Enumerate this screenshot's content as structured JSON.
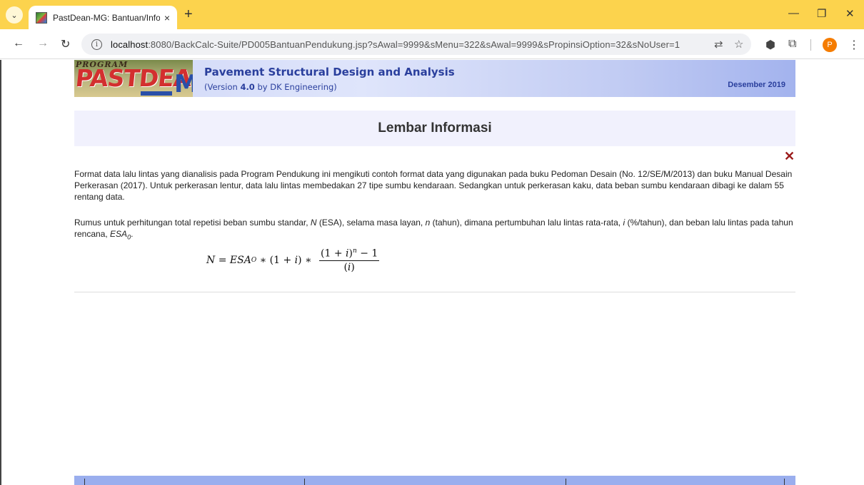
{
  "browser": {
    "tab_title": "PastDean-MG: Bantuan/Informa",
    "tab_close": "×",
    "new_tab": "+",
    "url_host": "localhost",
    "url_rest": ":8080/BackCalc-Suite/PD005BantuanPendukung.jsp?sAwal=9999&sMenu=322&sAwal=9999&sPropinsiOption=32&sNoUser=1",
    "profile_initial": "P"
  },
  "banner": {
    "logo_program": "PROGRAM",
    "logo_main": "PASTDEAN",
    "logo_suffix": "M",
    "title": "Pavement Structural Design and Analysis",
    "version_prefix": "(Version ",
    "version_number": "4.0",
    "version_suffix": " by DK Engineering)",
    "date": "Desember 2019"
  },
  "info": {
    "heading": "Lembar Informasi",
    "paragraph1": "Format data lalu lintas yang dianalisis pada Program Pendukung ini mengikuti contoh format data yang digunakan pada buku Pedoman Desain (No. 12/SE/M/2013) dan buku Manual Desain Perkerasan (2017). Untuk perkerasan lentur, data lalu lintas membedakan 27 tipe sumbu kendaraan. Sedangkan untuk perkerasan kaku, data beban sumbu kendaraan dibagi ke dalam 55 rentang data.",
    "p2_a": "Rumus untuk perhitungan total repetisi beban sumbu standar, ",
    "p2_N": "N",
    "p2_b": " (ESA), selama masa layan, ",
    "p2_n": "n",
    "p2_c": " (tahun), dimana pertumbuhan lalu lintas rata-rata, ",
    "p2_i": "i",
    "p2_d": " (%/tahun), dan beban lalu lintas pada tahun rencana, ",
    "p2_esa": "ESA",
    "p2_esa_sub": "0",
    "p2_end": "."
  },
  "formula": {
    "lhs": "N",
    "eq": " = ",
    "esa": "ESA",
    "esa_sub": "O",
    "mid": " ∗ (1 + ",
    "i": "i",
    "mid2": ") ∗ ",
    "num_open": "(1 + ",
    "num_i": "i",
    "num_close": ")",
    "num_exp": "n",
    "num_tail": " − 1",
    "den_open": "(",
    "den_i": "i",
    "den_close": ")"
  },
  "icons": {
    "close": "✕"
  }
}
